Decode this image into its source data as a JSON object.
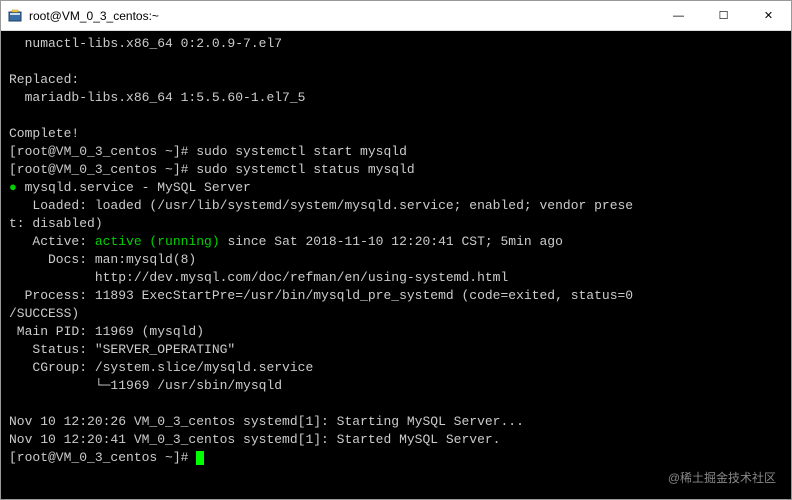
{
  "window": {
    "title": "root@VM_0_3_centos:~",
    "icon": "putty-icon"
  },
  "controls": {
    "min": "—",
    "max": "☐",
    "close": "✕"
  },
  "term": {
    "l01": "  numactl-libs.x86_64 0:2.0.9-7.el7",
    "l02": "",
    "l03": "Replaced:",
    "l04": "  mariadb-libs.x86_64 1:5.5.60-1.el7_5",
    "l05": "",
    "l06": "Complete!",
    "l07p": "[root@VM_0_3_centos ~]# ",
    "l07c": "sudo systemctl start mysqld",
    "l08p": "[root@VM_0_3_centos ~]# ",
    "l08c": "sudo systemctl status mysqld",
    "l09a": "●",
    "l09b": " mysqld.service - MySQL Server",
    "l10": "   Loaded: loaded (/usr/lib/systemd/system/mysqld.service; enabled; vendor prese",
    "l11": "t: disabled)",
    "l12a": "   Active: ",
    "l12b": "active (running)",
    "l12c": " since Sat 2018-11-10 12:20:41 CST; 5min ago",
    "l13": "     Docs: man:mysqld(8)",
    "l14": "           http://dev.mysql.com/doc/refman/en/using-systemd.html",
    "l15": "  Process: 11893 ExecStartPre=/usr/bin/mysqld_pre_systemd (code=exited, status=0",
    "l16": "/SUCCESS)",
    "l17": " Main PID: 11969 (mysqld)",
    "l18": "   Status: \"SERVER_OPERATING\"",
    "l19": "   CGroup: /system.slice/mysqld.service",
    "l20": "           └─11969 /usr/sbin/mysqld",
    "l21": "",
    "l22": "Nov 10 12:20:26 VM_0_3_centos systemd[1]: Starting MySQL Server...",
    "l23": "Nov 10 12:20:41 VM_0_3_centos systemd[1]: Started MySQL Server.",
    "l24p": "[root@VM_0_3_centos ~]# "
  },
  "watermark": "@稀土掘金技术社区"
}
